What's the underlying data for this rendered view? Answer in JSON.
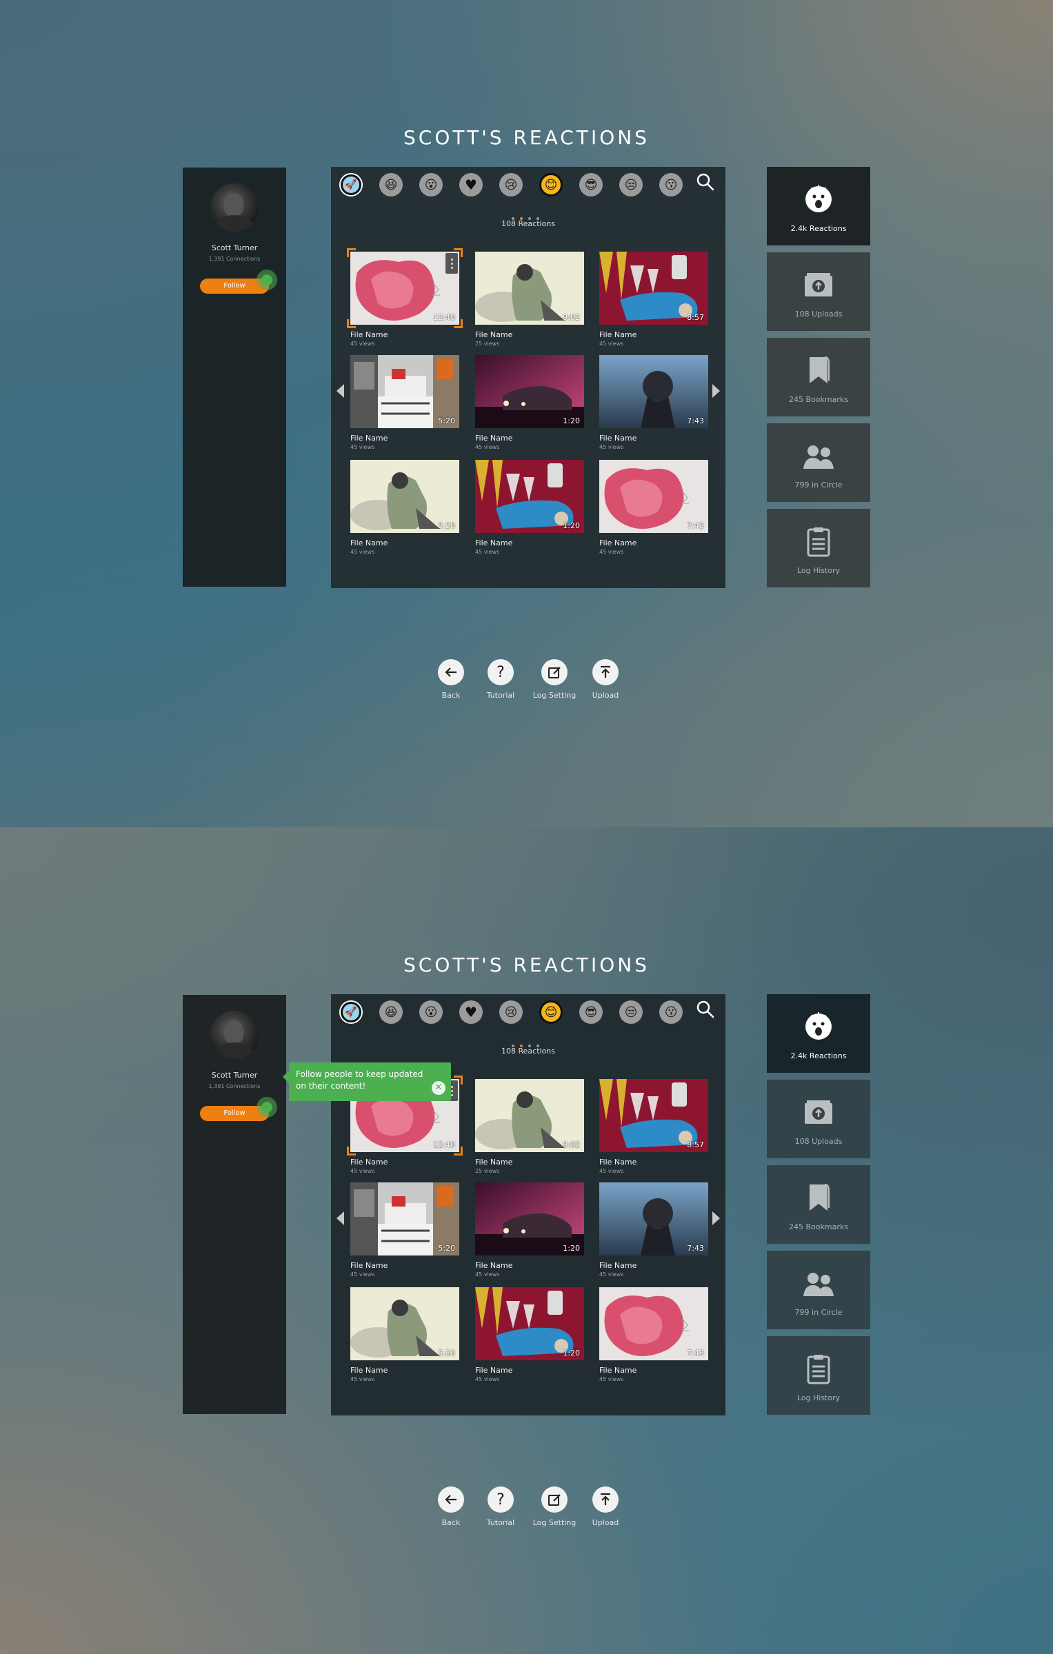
{
  "title": "SCOTT'S REACTIONS",
  "profile": {
    "name": "Scott Turner",
    "connections": "1,391 Connections",
    "follow_label": "Follow"
  },
  "reactions": {
    "count_label": "108 Reactions",
    "emoji_filters": [
      "rocket-icon",
      "laughing-face-icon",
      "shocked-face-icon",
      "heart-icon",
      "crying-face-icon",
      "smiling-face-icon",
      "sunglasses-face-icon",
      "unamused-face-icon",
      "kissing-face-icon"
    ],
    "selected_filter": "smiling-face-icon",
    "page_dots": 4,
    "active_page": 2
  },
  "grid": [
    {
      "name": "File Name",
      "views": "45 views",
      "duration": "12:40",
      "thumb": "pink-smoke"
    },
    {
      "name": "File Name",
      "views": "25 views",
      "duration": "9:02",
      "thumb": "sleeping-man"
    },
    {
      "name": "File Name",
      "views": "45 views",
      "duration": "8:57",
      "thumb": "robot-red"
    },
    {
      "name": "File Name",
      "views": "45 views",
      "duration": "5:20",
      "thumb": "street-shop"
    },
    {
      "name": "File Name",
      "views": "45 views",
      "duration": "1:20",
      "thumb": "car-night"
    },
    {
      "name": "File Name",
      "views": "45 views",
      "duration": "7:43",
      "thumb": "helmet-blue"
    },
    {
      "name": "File Name",
      "views": "45 views",
      "duration": "5:20",
      "thumb": "sleeping-man"
    },
    {
      "name": "File Name",
      "views": "45 views",
      "duration": "1:20",
      "thumb": "robot-red"
    },
    {
      "name": "File Name",
      "views": "45 views",
      "duration": "7:43",
      "thumb": "pink-smoke"
    }
  ],
  "sidebar": [
    {
      "label": "2.4k Reactions",
      "icon": "reaction-face-icon"
    },
    {
      "label": "108 Uploads",
      "icon": "upload-box-icon"
    },
    {
      "label": "245 Bookmarks",
      "icon": "bookmark-icon"
    },
    {
      "label": "799 in Circle",
      "icon": "people-icon"
    },
    {
      "label": "Log History",
      "icon": "clipboard-icon"
    }
  ],
  "bottom_actions": [
    {
      "label": "Back",
      "icon": "back-arrow-icon"
    },
    {
      "label": "Tutorial",
      "icon": "question-icon"
    },
    {
      "label": "Log Setting",
      "icon": "edit-icon"
    },
    {
      "label": "Upload",
      "icon": "upload-arrow-icon"
    }
  ],
  "tooltip": {
    "text": "Follow people to keep updated on their content!",
    "close_icon": "close-icon"
  },
  "colors": {
    "accent": "#f07f12",
    "tooltip": "#4caf50",
    "panel": "#243034"
  }
}
